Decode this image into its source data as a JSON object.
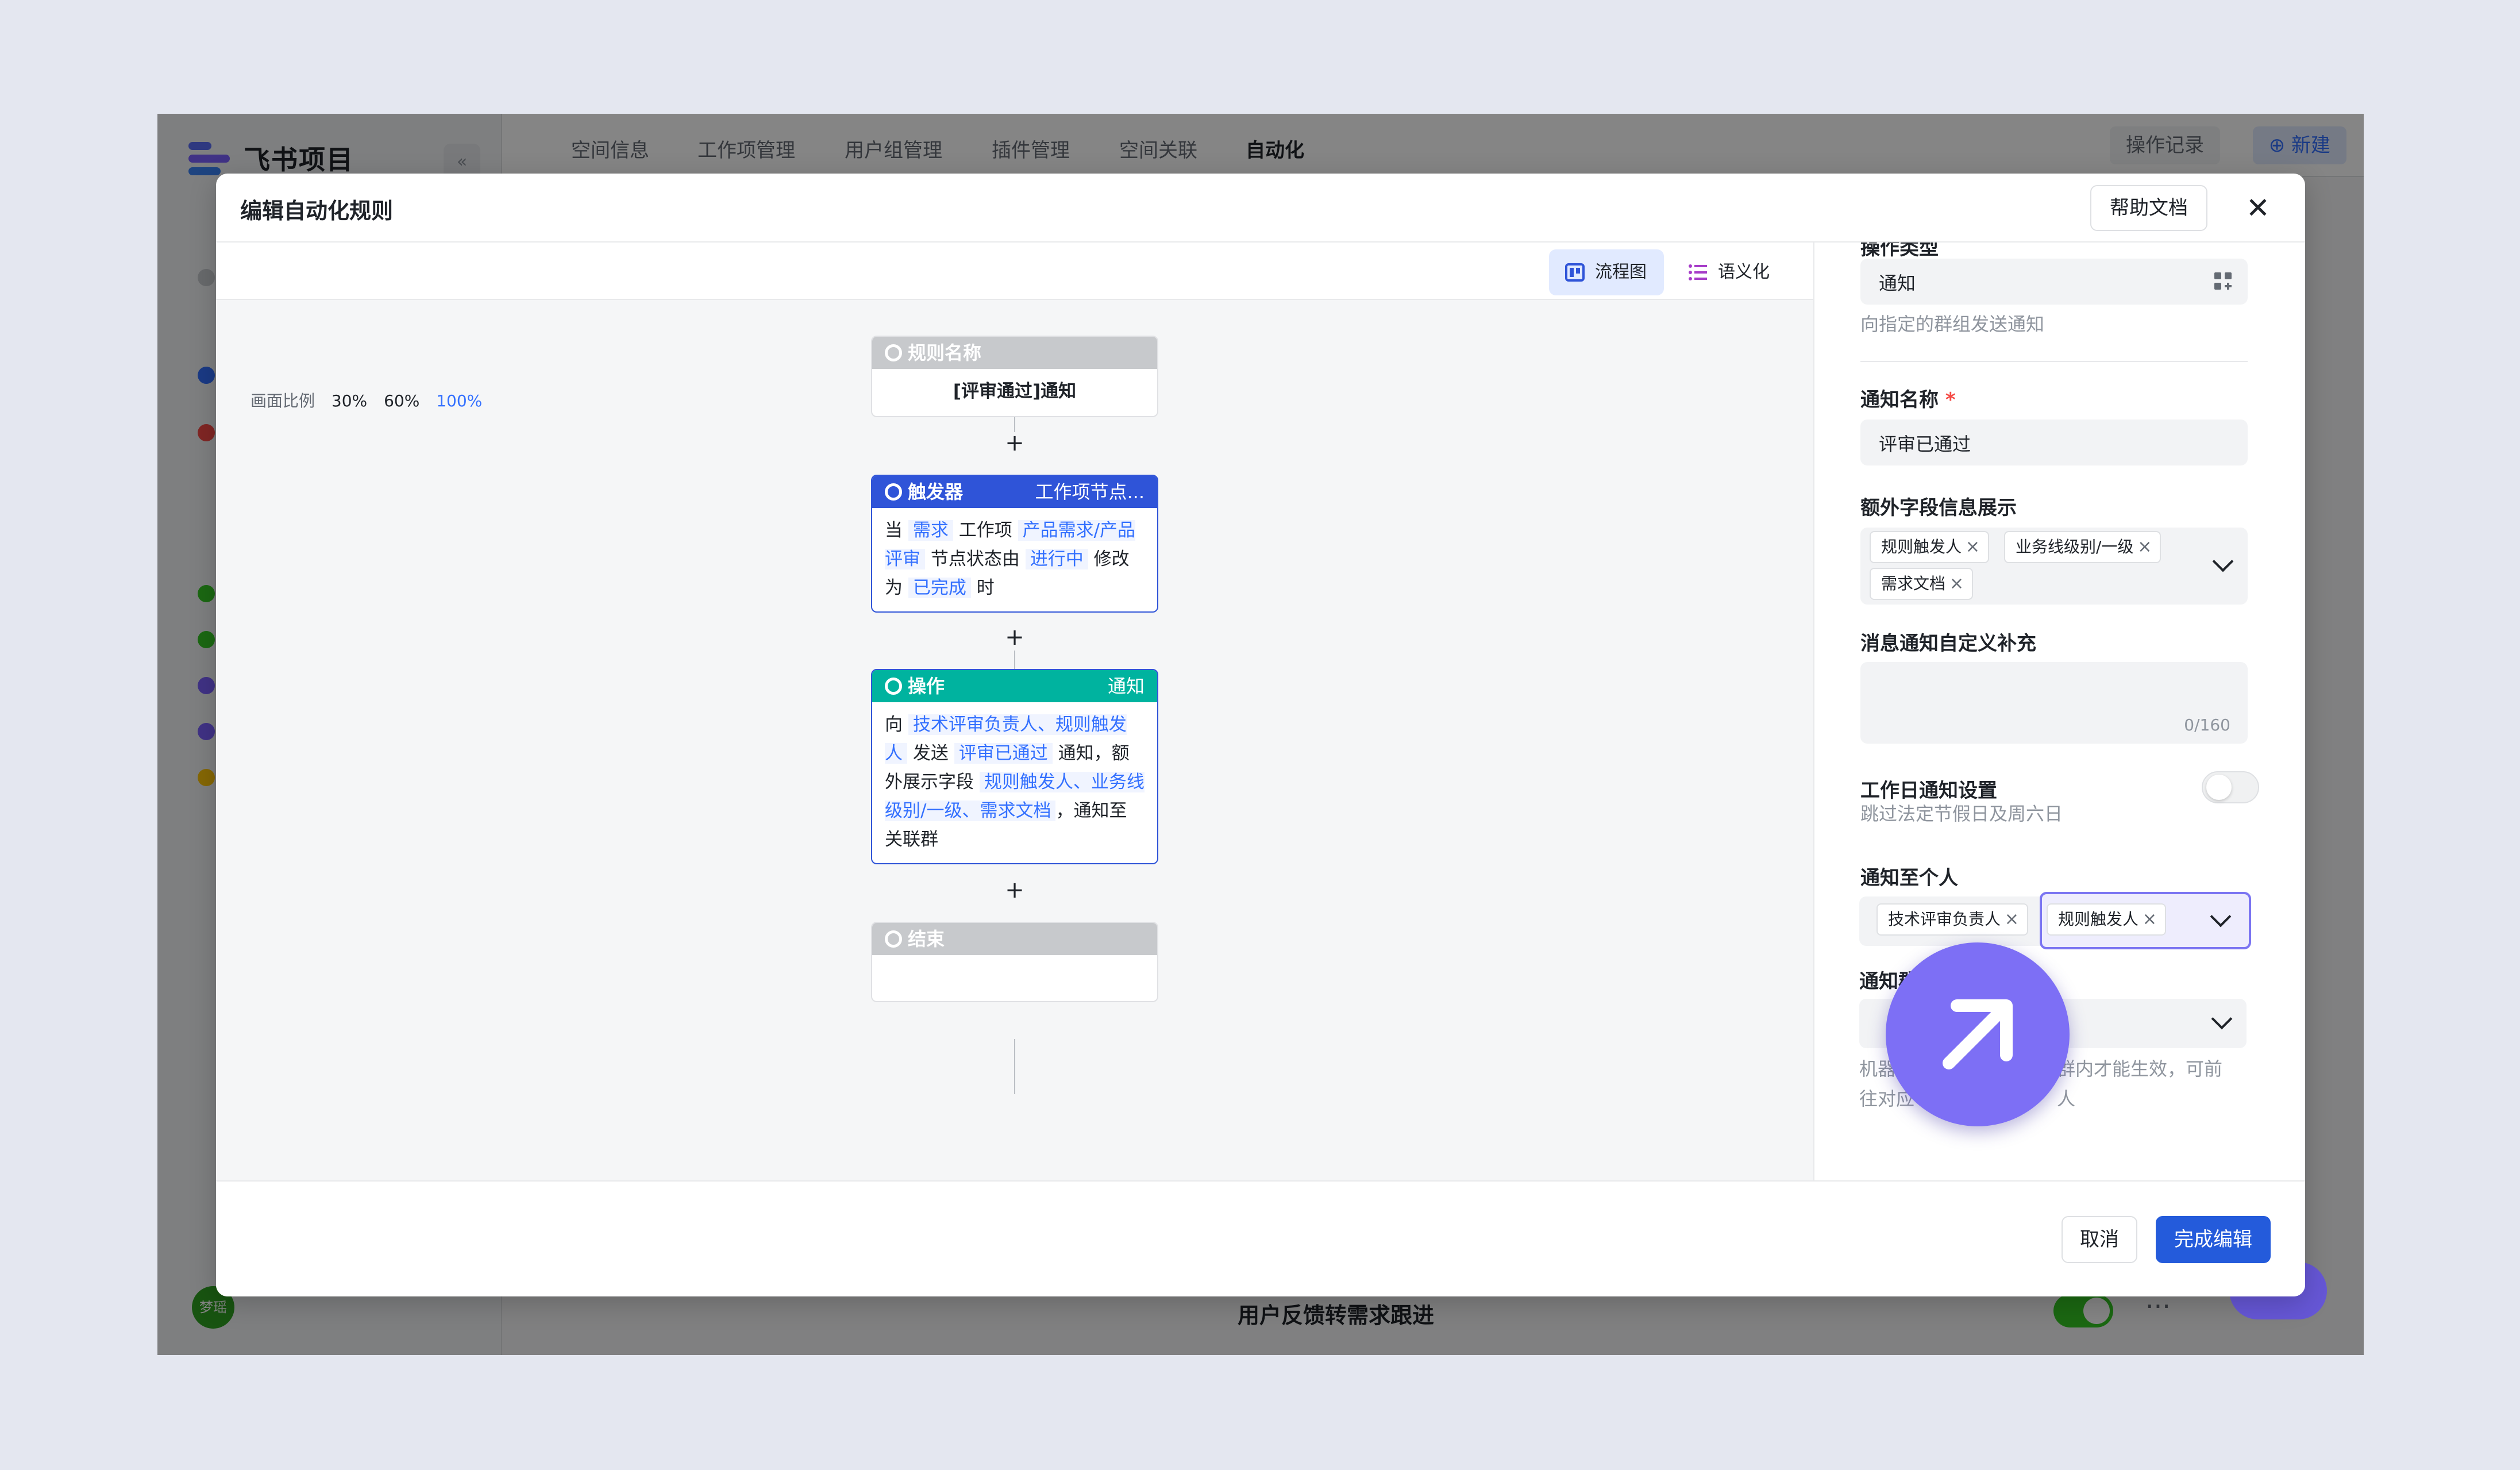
{
  "app": {
    "name": "飞书项目",
    "collapse_icon": "«",
    "tabs": [
      "空间信息",
      "工作项管理",
      "用户组管理",
      "插件管理",
      "空间关联",
      "自动化"
    ],
    "active_tab": "自动化",
    "log_label": "操作记录",
    "new_label": "新建",
    "avatar_text": "梦瑶",
    "row_title": "用户反馈转需求跟进",
    "row_more": "···"
  },
  "dialog": {
    "title": "编辑自动化规则",
    "help_label": "帮助文档",
    "close_icon": "✕",
    "cancel_label": "取消",
    "done_label": "完成编辑"
  },
  "canvas": {
    "view_flow": "流程图",
    "view_semantic": "语义化",
    "scale_label": "画面比例",
    "scales": [
      "30%",
      "60%",
      "100%"
    ],
    "plus": "+"
  },
  "flow": {
    "rule": {
      "head": "规则名称",
      "body": "[评审通过]通知"
    },
    "trigger": {
      "head": "触发器",
      "right": "工作项节点...",
      "t1": "当",
      "c1": "需求",
      "t2": "工作项",
      "c2": "产品需求/产品评审",
      "t3": "节点状态由",
      "c3": "进行中",
      "t4": "修改为",
      "c4": "已完成",
      "t5": "时"
    },
    "action": {
      "head": "操作",
      "right": "通知",
      "t1": "向",
      "c1": "技术评审负责人、规则触发人",
      "t2": "发送",
      "c2": "评审已通过",
      "t3": "通知",
      "t4": "，额外展示字段",
      "c3": "规则触发人、业务线级别/一级、需求文档",
      "t5": "，通知至关联群"
    },
    "end": {
      "head": "结束"
    }
  },
  "form": {
    "partial_label": "操作类型",
    "action_type_value": "通知",
    "action_type_hint": "向指定的群组发送通知",
    "notice_name_label": "通知名称",
    "required_mark": "*",
    "notice_name_value": "评审已通过",
    "extra_fields_label": "额外字段信息展示",
    "extra_tags": [
      "规则触发人",
      "业务线级别/一级",
      "需求文档"
    ],
    "tag_close": "×",
    "custom_label": "消息通知自定义补充",
    "custom_counter": "0/160",
    "workday_label": "工作日通知设置",
    "workday_hint": "跳过法定节假日及周六日",
    "personal_label": "通知至个人",
    "personal_tags": [
      "技术评审负责人",
      "规则触发人"
    ],
    "group_label_partial": "通知群",
    "group_hint_left": "机器",
    "group_hint_right": "群内才能生效，可前",
    "group_hint_left2": "往对应",
    "group_hint_right2": "人"
  },
  "colors": {
    "trigger": "#2f54d8",
    "action": "#00b39f",
    "end": "#c7c9cc",
    "primary": "#245bdb",
    "accent": "#7d6ff5"
  }
}
